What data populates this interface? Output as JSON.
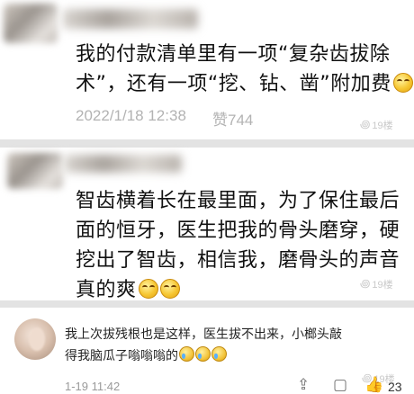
{
  "comments": [
    {
      "text": "我的付款清单里有一项“复杂齿拔除术”，还有一项“挖、钻、凿”附加费",
      "lines": [
        "我的付款清单里有一项“复杂齿拔除",
        "术”，还有一项“挖、钻、凿”附加费"
      ],
      "emojis": [
        "smile-emoji"
      ],
      "date": "2022/1/18 12:38",
      "likes_label": "赞744",
      "watermark": "19楼"
    },
    {
      "lines": [
        "智齿横着长在最里面，为了保住最后",
        "面的恒牙，医生把我的骨头磨穿，硬",
        "挖出了智齿，相信我，磨骨头的声音",
        "真的爽"
      ],
      "emojis": [
        "smile-emoji",
        "smile-emoji"
      ],
      "watermark": "19楼"
    },
    {
      "lines": [
        "我上次拔残根也是这样，医生拔不出来，小榔头敲",
        "得我脑瓜子嗡嗡嗡的"
      ],
      "emojis": [
        "cry-laugh-emoji",
        "cry-laugh-emoji",
        "cry-laugh-emoji"
      ],
      "date": "1-19 11:42",
      "like_count": "23",
      "watermark": "19楼"
    }
  ],
  "icons": {
    "share": "share-icon",
    "comment": "comment-icon",
    "like": "thumbs-up-icon",
    "watermark": "swirl-icon"
  }
}
